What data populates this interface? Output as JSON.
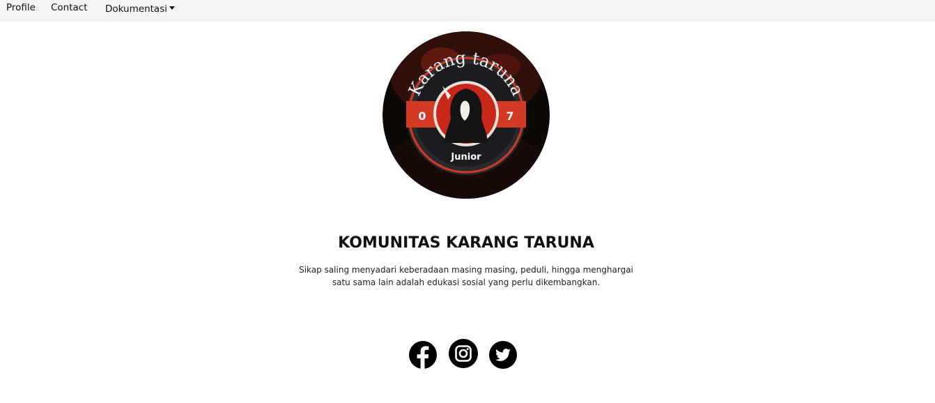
{
  "nav": {
    "profile": "Profile",
    "contact": "Contact",
    "documentation": "Dokumentasi"
  },
  "logo": {
    "top_text": "Karang taruna",
    "left_number": "0",
    "right_number": "7",
    "bottom_text": "Junior"
  },
  "hero": {
    "title": "KOMUNITAS KARANG TARUNA",
    "description": "Sikap saling menyadari keberadaan masing masing, peduli, hingga menghargai satu sama lain adalah edukasi sosial yang perlu dikembangkan."
  },
  "social": {
    "icons": [
      "facebook-icon",
      "instagram-icon",
      "twitter-icon"
    ]
  },
  "colors": {
    "nav_bg": "#f4f4f4",
    "logo_red": "#d23a23",
    "logo_dark": "#1c1c1c"
  }
}
